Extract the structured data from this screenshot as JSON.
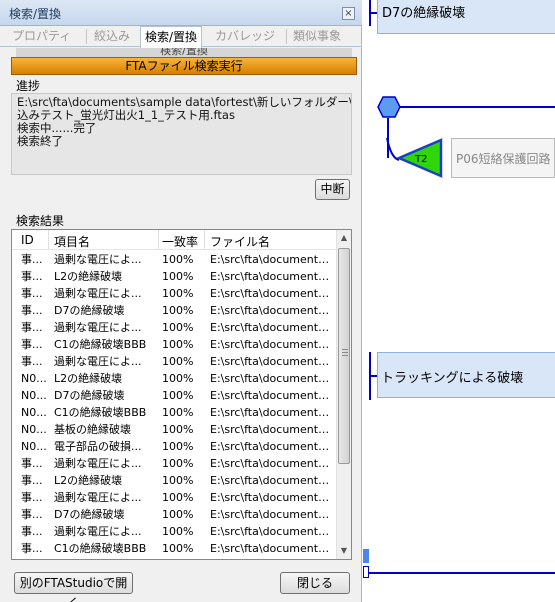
{
  "panel": {
    "title": "検索/置換",
    "close_glyph": "×",
    "tabs": [
      "プロパティ",
      "絞込み",
      "検索/置換",
      "カバレッジ",
      "類似事象"
    ],
    "ghost_label": "検索/置換",
    "run_button": "FTAファイル検索実行",
    "progress_label": "進捗",
    "progress_lines": [
      "E:\\src\\fta\\documents\\sample data\\fortest\\新しいフォルダー\\絞",
      "込みテスト_蛍光灯出火1_1_テスト用.ftas",
      "検索中......完了",
      "検索終了"
    ],
    "abort_button": "中断",
    "results_label": "検索結果",
    "columns": [
      "ID",
      "項目名",
      "一致率",
      "ファイル名"
    ],
    "rows": [
      [
        "事...",
        "過剰な電圧によ...",
        "100%",
        "E:\\src\\fta\\documents\\..."
      ],
      [
        "事...",
        "L2の絶縁破壊",
        "100%",
        "E:\\src\\fta\\documents\\..."
      ],
      [
        "事...",
        "過剰な電圧によ...",
        "100%",
        "E:\\src\\fta\\documents\\..."
      ],
      [
        "事...",
        "D7の絶縁破壊",
        "100%",
        "E:\\src\\fta\\documents\\..."
      ],
      [
        "事...",
        "過剰な電圧によ...",
        "100%",
        "E:\\src\\fta\\documents\\..."
      ],
      [
        "事...",
        "C1の絶縁破壊BBB",
        "100%",
        "E:\\src\\fta\\documents\\..."
      ],
      [
        "事...",
        "過剰な電圧によ...",
        "100%",
        "E:\\src\\fta\\documents\\..."
      ],
      [
        "N0...",
        "L2の絶縁破壊",
        "100%",
        "E:\\src\\fta\\documents\\..."
      ],
      [
        "N0...",
        "D7の絶縁破壊",
        "100%",
        "E:\\src\\fta\\documents\\..."
      ],
      [
        "N0...",
        "C1の絶縁破壊BBB",
        "100%",
        "E:\\src\\fta\\documents\\..."
      ],
      [
        "N0...",
        "基板の絶縁破壊",
        "100%",
        "E:\\src\\fta\\documents\\..."
      ],
      [
        "N0...",
        "電子部品の破損...",
        "100%",
        "E:\\src\\fta\\documents\\..."
      ],
      [
        "事...",
        "過剰な電圧によ...",
        "100%",
        "E:\\src\\fta\\documents\\..."
      ],
      [
        "事...",
        "L2の絶縁破壊",
        "100%",
        "E:\\src\\fta\\documents\\..."
      ],
      [
        "事...",
        "過剰な電圧によ...",
        "100%",
        "E:\\src\\fta\\documents\\..."
      ],
      [
        "事...",
        "D7の絶縁破壊",
        "100%",
        "E:\\src\\fta\\documents\\..."
      ],
      [
        "事...",
        "過剰な電圧によ...",
        "100%",
        "E:\\src\\fta\\documents\\..."
      ],
      [
        "事...",
        "C1の絶縁破壊BBB",
        "100%",
        "E:\\src\\fta\\documents\\..."
      ]
    ],
    "open_button": "別のFTAStudioで開く",
    "close_button": "閉じる",
    "scroll_position": 0.0
  },
  "canvas": {
    "nodes": {
      "d7": "D7の絶縁破壊",
      "tracking": "トラッキングによる破壊",
      "p06": "P06短絡保護回路"
    },
    "transfer_label": "T2",
    "colors": {
      "line": "#0000c8",
      "node_fill": "#d9e6f7",
      "transfer_fill": "#2fd60c",
      "run_button": "#e08a00"
    }
  }
}
